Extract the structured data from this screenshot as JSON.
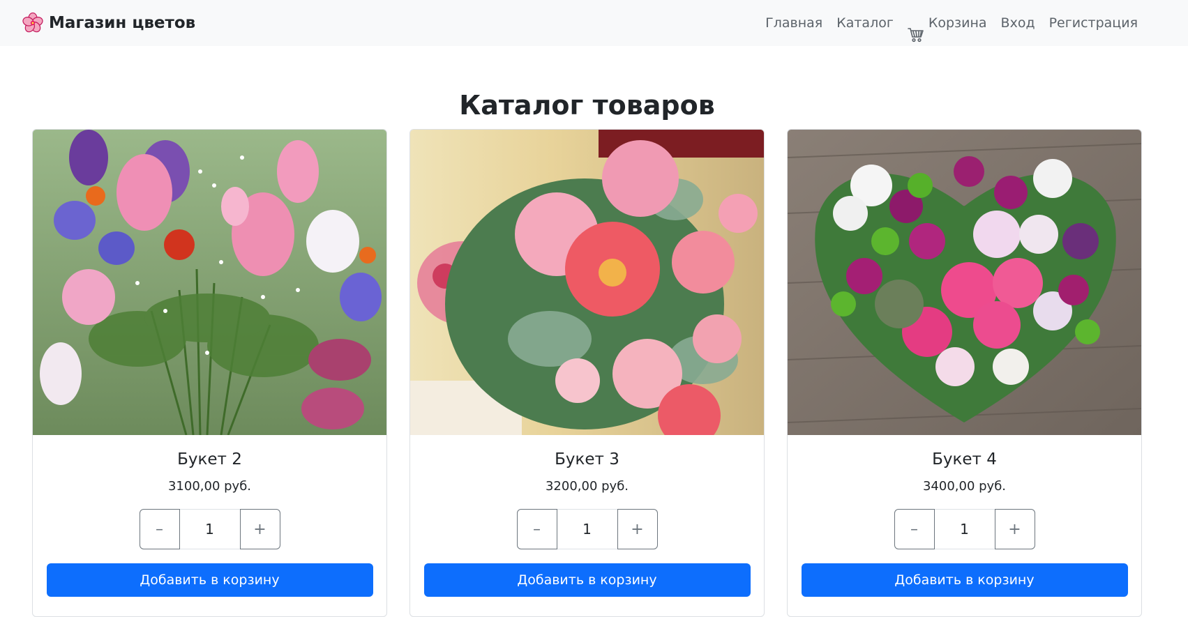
{
  "navbar": {
    "brand_icon": "sakura-flower-icon",
    "brand_text": "Магазин цветов",
    "links": {
      "home": "Главная",
      "catalog": "Каталог",
      "cart": "Корзина",
      "login": "Вход",
      "register": "Регистрация"
    },
    "cart_icon": "shopping-cart-icon"
  },
  "catalog": {
    "title": "Каталог товаров",
    "products": [
      {
        "name": "Букет 2",
        "price": "3100,00 руб.",
        "quantity": "1",
        "image": "wildflower-bouquet-photo"
      },
      {
        "name": "Букет 3",
        "price": "3200,00 руб.",
        "quantity": "1",
        "image": "peony-rose-bouquet-photo"
      },
      {
        "name": "Букет 4",
        "price": "3400,00 руб.",
        "quantity": "1",
        "image": "heart-flower-box-photo"
      }
    ],
    "minus_symbol": "–",
    "plus_symbol": "+",
    "add_to_cart_label": "Добавить в корзину"
  },
  "colors": {
    "primary": "#0d6efd",
    "navbar_bg": "#f8f9fa",
    "nav_link": "#5c636a",
    "text": "#212529"
  }
}
